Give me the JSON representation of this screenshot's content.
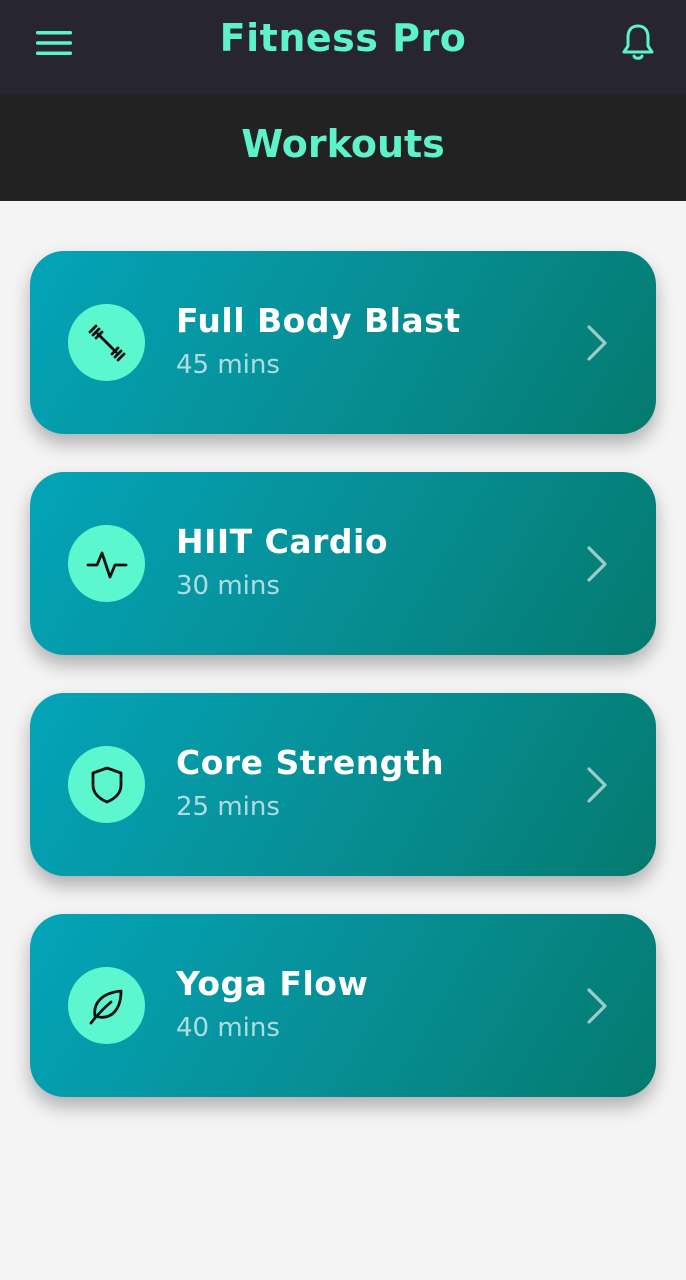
{
  "header": {
    "app_title": "Fitness Pro",
    "menu_icon": "hamburger-menu-icon",
    "notification_icon": "bell-icon"
  },
  "subheader": {
    "title": "Workouts"
  },
  "workouts": [
    {
      "title": "Full Body Blast",
      "duration": "45 mins",
      "icon": "dumbbell-icon"
    },
    {
      "title": "HIIT Cardio",
      "duration": "30 mins",
      "icon": "activity-pulse-icon"
    },
    {
      "title": "Core Strength",
      "duration": "25 mins",
      "icon": "shield-icon"
    },
    {
      "title": "Yoga Flow",
      "duration": "40 mins",
      "icon": "leaf-icon"
    }
  ],
  "colors": {
    "accent": "#5df2c9",
    "topbar_bg": "#272530",
    "subheader_bg": "#222222",
    "card_gradient_start": "#03a4b8",
    "card_gradient_end": "#047a6f",
    "page_bg": "#f4f4f4"
  }
}
